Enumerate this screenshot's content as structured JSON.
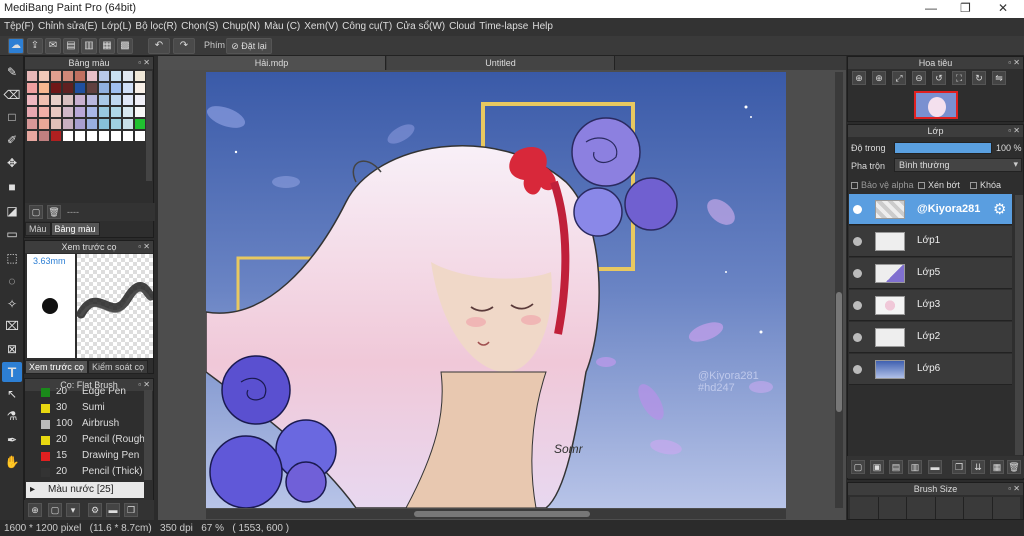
{
  "window": {
    "title": "MediBang Paint Pro (64bit)"
  },
  "menu": [
    "Tệp(F)",
    "Chỉnh sửa(E)",
    "Lớp(L)",
    "Bộ lọc(R)",
    "Chọn(S)",
    "Chụp(N)",
    "Màu (C)",
    "Xem(V)",
    "Công cụ(T)",
    "Cửa sổ(W)",
    "Cloud",
    "Time-lapse",
    "Help"
  ],
  "toolbar": {
    "key_label": "Phím",
    "setup_label": "Đặt lại"
  },
  "color_panel": {
    "title": "Bảng màu",
    "tab_color": "Màu",
    "tab_palette": "Bảng màu",
    "dashes": "----",
    "swatches": [
      "#e8b8b8",
      "#f0c8b8",
      "#e0a090",
      "#d08878",
      "#c07060",
      "#e8c0c8",
      "#b8c8e8",
      "#c8e0f0",
      "#e0e8f0",
      "#f0e8d8",
      "#f0a0a0",
      "#f8b890",
      "#701818",
      "#602020",
      "#2050a0",
      "#604040",
      "#90b0e0",
      "#a0c0f0",
      "#d0e0f8",
      "#f8f0e8",
      "#f0b8c0",
      "#f0c0b0",
      "#e8d0c8",
      "#d8c0c0",
      "#c8b0d0",
      "#b8b8e0",
      "#a8c8e8",
      "#c0d8f0",
      "#e0e8f8",
      "#f0f0f8",
      "#e8a8b0",
      "#f0b0a8",
      "#e8c8c0",
      "#d0b8c8",
      "#b8a8d8",
      "#a8b8e8",
      "#98c8e0",
      "#b0d8e8",
      "#d8e8f0",
      "#f8f8f8",
      "#d89898",
      "#e8a898",
      "#e0c0b8",
      "#c8b0c0",
      "#a8a0d0",
      "#98b0e0",
      "#88c0d8",
      "#a0d0e0",
      "#c8e0e8",
      "#20c030",
      "#e8a8a0",
      "#c08080",
      "#b02020",
      "#ffffff",
      "#ffffff",
      "#ffffff",
      "#ffffff",
      "#ffffff",
      "#ffffff",
      "#ffffff"
    ]
  },
  "brush_preview": {
    "title": "Xem trước cọ",
    "size": "3.63mm",
    "tab_preview": "Xem trước cọ",
    "tab_control": "Kiểm soát cọ"
  },
  "brush_panel": {
    "title": "Cọ: Flat Brush",
    "brushes": [
      {
        "size": "20",
        "name": "Edge Pen",
        "color": "#1a8a1a"
      },
      {
        "size": "30",
        "name": "Sumi",
        "color": "#e8d810"
      },
      {
        "size": "100",
        "name": "Airbrush",
        "color": "#bbbbbb"
      },
      {
        "size": "20",
        "name": "Pencil (Rough)",
        "color": "#e8d810"
      },
      {
        "size": "15",
        "name": "Drawing Pen",
        "color": "#e02020"
      },
      {
        "size": "20",
        "name": "Pencil (Thick)",
        "color": "#333333"
      }
    ],
    "group_label": "Màu nước [25]"
  },
  "document_tabs": [
    "Hải.mdp",
    "Untitled"
  ],
  "artwork": {
    "watermark_1": "@Kiyora281",
    "watermark_2": "#hd247",
    "signature": "Somr"
  },
  "navigator": {
    "title": "Hoa tiêu"
  },
  "layers_panel": {
    "title": "Lớp",
    "opacity_label": "Độ trong",
    "opacity_value": "100 %",
    "opacity_fraction": 1.0,
    "blend_label": "Pha trộn",
    "blend_value": "Bình thường",
    "protect_alpha": "Bảo vệ alpha",
    "clipping": "Xén bớt",
    "lock": "Khóa",
    "layers": [
      {
        "name": "@Kiyora281",
        "selected": true
      },
      {
        "name": "Lớp1",
        "selected": false
      },
      {
        "name": "Lớp5",
        "selected": false
      },
      {
        "name": "Lớp3",
        "selected": false
      },
      {
        "name": "Lớp2",
        "selected": false
      },
      {
        "name": "Lớp6",
        "selected": false
      }
    ]
  },
  "brush_size_panel": {
    "title": "Brush Size"
  },
  "status": {
    "dimensions": "1600 * 1200 pixel",
    "physical": "(11.6 * 8.7cm)",
    "dpi": "350 dpi",
    "zoom": "67 %",
    "cursor": "( 1553, 600 )"
  }
}
